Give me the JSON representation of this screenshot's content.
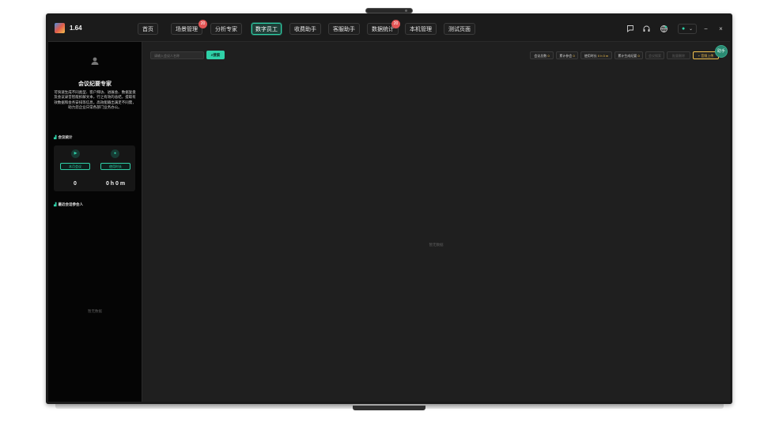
{
  "app": {
    "version": "1.64"
  },
  "nav": [
    {
      "label": "首页"
    },
    {
      "label": "场景管理",
      "badge": "20"
    },
    {
      "label": "分析专家"
    },
    {
      "label": "数字员工",
      "active": true
    },
    {
      "label": "收费助手"
    },
    {
      "label": "客服助手"
    },
    {
      "label": "数据统计",
      "badge": "20"
    },
    {
      "label": "本机管理"
    },
    {
      "label": "测试页面"
    }
  ],
  "topbar_icons": [
    "message-icon",
    "headset-icon",
    "globe-icon",
    "user-icon",
    "minimize-icon",
    "close-icon"
  ],
  "window": {
    "minimize": "−",
    "close": "×"
  },
  "sidebar": {
    "title": "会议纪要专家",
    "description": "可快速生成不同类型、客户拜访、进展会、数据复盘及会议录音智能拆解文本，行之有效的总结，提取有效数据和会务安排等信息，高效能输出满足不同需，助力您企业日常各部门业务办公。",
    "stats_title": "会议统计",
    "stats": [
      {
        "icon": "video-icon",
        "button": "本月会议",
        "value": "0"
      },
      {
        "icon": "timer-icon",
        "button": "使用时长",
        "value": "0 h 0 m"
      }
    ],
    "recent_title": "最近会话参会人",
    "empty_text": "暂无数据"
  },
  "main": {
    "search_placeholder": "请输入会议人名称",
    "search_button": "搜索",
    "toolbar": [
      {
        "label": "会议总数",
        "value": "0"
      },
      {
        "label": "累计参会",
        "value": "0"
      },
      {
        "label": "使用时长",
        "value": "0 h 0 m"
      },
      {
        "label": "累计生成纪要",
        "value": "0"
      },
      {
        "label": "会议搜索"
      },
      {
        "label": "批量删除"
      },
      {
        "label": "+ 音频上传"
      }
    ],
    "empty_text": "暂无数据"
  },
  "float_button": {
    "label": "助手"
  },
  "colors": {
    "accent": "#2fd1a8",
    "highlight": "#f2c14e",
    "badge": "#e25555",
    "background": "#1f1f1f",
    "sidebar": "#050505"
  }
}
